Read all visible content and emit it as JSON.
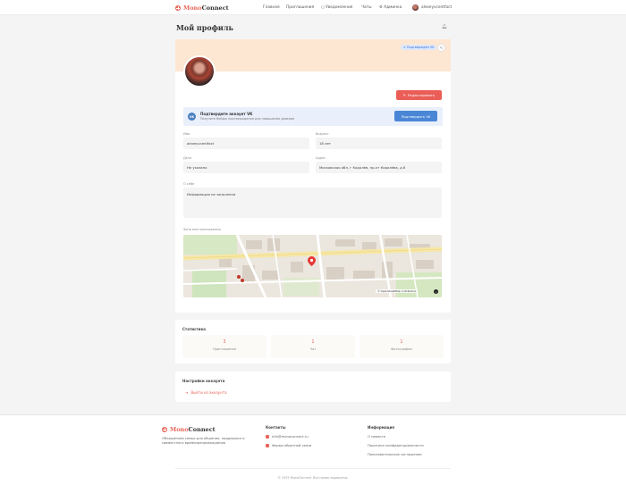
{
  "brand": {
    "name_part1": "Mono",
    "name_part2": "Connect",
    "accent": "#e8665a"
  },
  "nav": {
    "items": [
      "Главная",
      "Приглашения",
      "Уведомления",
      "Чаты",
      "Админка"
    ],
    "username": "alexeyvcentfact"
  },
  "page": {
    "title": "Мой профиль"
  },
  "profile": {
    "verified_badge": "Подтверждён VK",
    "edit_button": "Редактировать",
    "vk_banner": {
      "logo": "VK",
      "title": "Подтвердите аккаунт VK",
      "subtitle": "Получите бейдж подтверждения для повышения доверия",
      "button": "Подтвердить VK"
    },
    "fields": {
      "name_label": "Имя",
      "name_value": "alexeyvcentfact",
      "age_label": "Возраст",
      "age_value": "18 лет",
      "children_label": "Дети",
      "children_value": "Не указано",
      "address_label": "Адрес",
      "address_value": "Московская обл, г Королёв, пр-кт Королёва, д 8",
      "about_label": "О себе",
      "about_value": "Информация не заполнена",
      "map_label": "Зона местоположения",
      "map_attribution": "© OpenStreetMap contributors"
    }
  },
  "stats": {
    "title": "Статистика",
    "items": [
      {
        "value": "3",
        "label": "Приглашения"
      },
      {
        "value": "1",
        "label": "Чат"
      },
      {
        "value": "1",
        "label": "Фотографии"
      }
    ]
  },
  "settings": {
    "title": "Настройки аккаунта",
    "logout": "Выйти из аккаунта"
  },
  "footer": {
    "about": "Объединяем семьи для общения, поддержки и совместного времяпрепровождения",
    "contacts_title": "Контакты",
    "contacts": [
      "info@monoconnect.ru",
      "Форма обратной связи"
    ],
    "info_title": "Информация",
    "info_links": [
      "О проекте",
      "Политика конфиденциальности",
      "Пользовательское соглашение"
    ],
    "copyright": "© 2025 MonoConnect. Все права защищены."
  }
}
